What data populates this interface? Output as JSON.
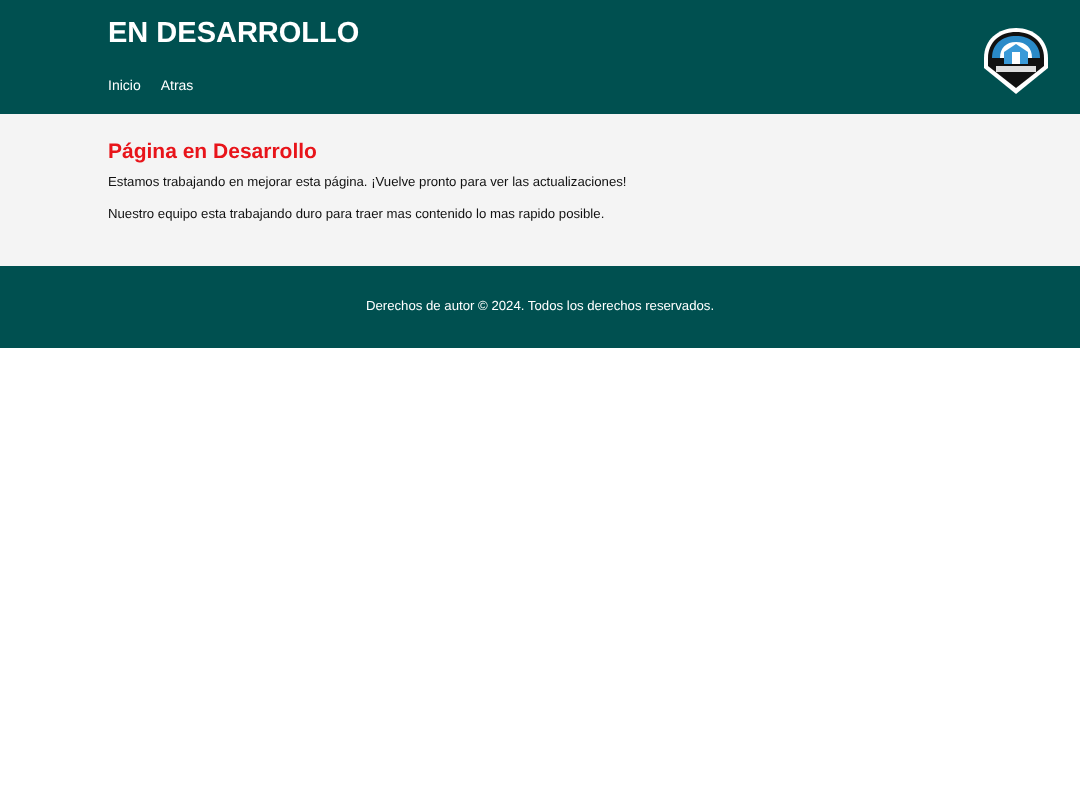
{
  "header": {
    "title": "EN DESARROLLO",
    "nav": [
      "Inicio",
      "Atras"
    ]
  },
  "main": {
    "heading": "Página en Desarrollo",
    "paragraphs": [
      "Estamos trabajando en mejorar esta página. ¡Vuelve pronto para ver las actualizaciones!",
      "Nuestro equipo esta trabajando duro para traer mas contenido lo mas rapido posible."
    ]
  },
  "footer": {
    "text": "Derechos de autor © 2024. Todos los derechos reservados."
  }
}
